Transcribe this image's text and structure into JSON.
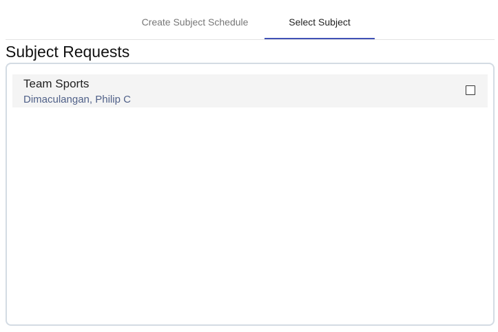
{
  "tabs": [
    {
      "label": "Create Subject Schedule",
      "active": false
    },
    {
      "label": "Select Subject",
      "active": true
    }
  ],
  "colors": {
    "active_tab_indicator": "#3f51b5",
    "subtitle_text": "#4f6088",
    "panel_border": "#d3dbe3",
    "item_background": "#f4f4f4"
  },
  "section": {
    "title": "Subject Requests"
  },
  "requests": [
    {
      "title": "Team Sports",
      "subtitle": "Dimaculangan, Philip C",
      "checked": false
    }
  ]
}
